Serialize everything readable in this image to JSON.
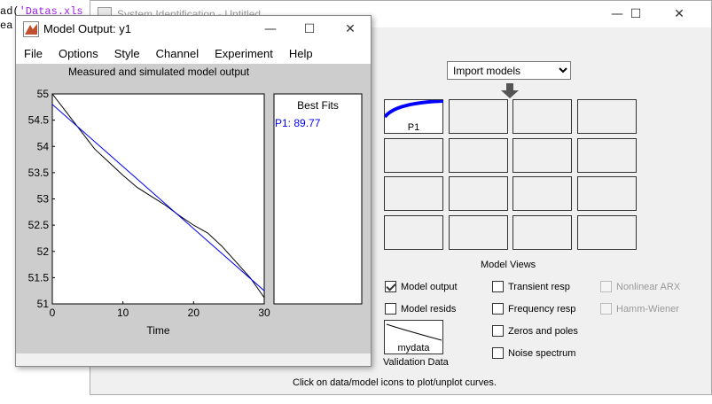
{
  "editor": {
    "line1_prefix": "ad(",
    "line1_string": "'Datas.xls",
    "line2": "ea"
  },
  "sysid_window": {
    "title": "System Identification - Untitled",
    "controls": {
      "minimize": "—",
      "maximize": "☐",
      "close": "✕"
    },
    "import_models": {
      "selected": "Import models"
    },
    "model_tiles": [
      {
        "label": "P1",
        "color": "#0000ff"
      }
    ],
    "model_views_heading": "Model Views",
    "model_views": {
      "model_output": {
        "label": "Model output",
        "checked": true
      },
      "model_resids": {
        "label": "Model resids",
        "checked": false
      },
      "transient_resp": {
        "label": "Transient resp",
        "checked": false
      },
      "frequency_resp": {
        "label": "Frequency resp",
        "checked": false
      },
      "zeros_and_poles": {
        "label": "Zeros and poles",
        "checked": false
      },
      "noise_spectrum": {
        "label": "Noise spectrum",
        "checked": false
      },
      "nonlinear_arx": {
        "label": "Nonlinear ARX",
        "checked": false,
        "disabled": true
      },
      "hamm_wiener": {
        "label": "Hamm-Wiener",
        "checked": false,
        "disabled": true
      }
    },
    "validation": {
      "tile_label": "mydata",
      "caption": "Validation Data"
    },
    "hint": "Click on data/model icons to plot/unplot curves."
  },
  "model_output_window": {
    "title": "Model Output: y1",
    "menu": [
      "File",
      "Options",
      "Style",
      "Channel",
      "Experiment",
      "Help"
    ],
    "controls": {
      "minimize": "—",
      "maximize": "☐",
      "close": "✕"
    },
    "best_fits": {
      "heading": "Best Fits",
      "entries": [
        {
          "text": "P1: 89.77",
          "color": "#0000ff"
        }
      ]
    }
  },
  "chart_data": {
    "type": "line",
    "title": "Measured and simulated model output",
    "xlabel": "Time",
    "ylabel": "",
    "xlim": [
      0,
      30
    ],
    "ylim": [
      51,
      55
    ],
    "xticks": [
      0,
      10,
      20,
      30
    ],
    "yticks": [
      51,
      51.5,
      52,
      52.5,
      53,
      53.5,
      54,
      54.5,
      55
    ],
    "ytick_labels": [
      "51",
      "51.5",
      "52",
      "52.5",
      "53",
      "53.5",
      "54",
      "54.5",
      "55"
    ],
    "grid": false,
    "series": [
      {
        "color": "#000000",
        "x": [
          0,
          2,
          4,
          6,
          8,
          10,
          12,
          14,
          16,
          18,
          20,
          22,
          24,
          26,
          28,
          30
        ],
        "y": [
          55.0,
          54.65,
          54.3,
          53.95,
          53.7,
          53.45,
          53.22,
          53.05,
          52.88,
          52.68,
          52.5,
          52.35,
          52.1,
          51.8,
          51.5,
          51.12
        ]
      },
      {
        "color": "#0000ff",
        "x": [
          0,
          30
        ],
        "y": [
          54.8,
          51.25
        ]
      }
    ]
  }
}
